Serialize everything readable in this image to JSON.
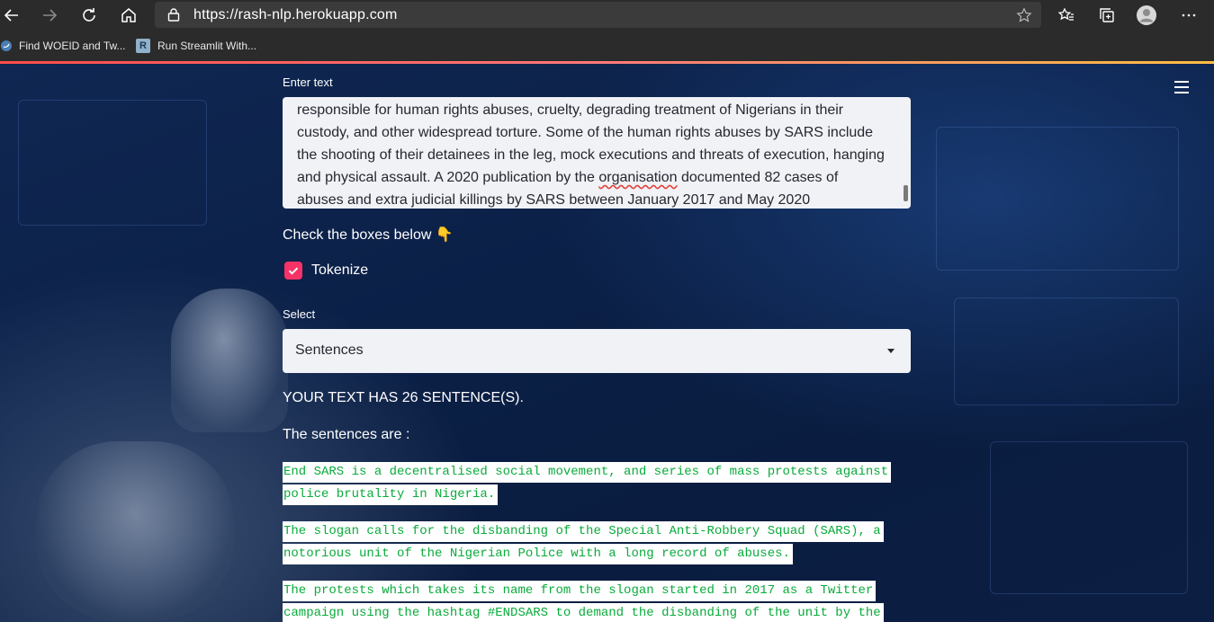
{
  "browser": {
    "url": "https://rash-nlp.herokuapp.com",
    "bookmarks": [
      {
        "label": "Find WOEID and Tw..."
      },
      {
        "label": "Run Streamlit With..."
      }
    ],
    "bookmark_badge": "R"
  },
  "app": {
    "input_label": "Enter text",
    "input_lines": [
      "responsible for human rights abuses, cruelty, degrading treatment of Nigerians in their",
      "custody, and other widespread torture. Some of the human rights abuses by SARS include",
      "the shooting of their detainees in the leg, mock executions and threats of execution, hanging",
      "and physical assault. A 2020 publication by the ",
      "organisation",
      " documented 82 cases of",
      "abuses and extra judicial killings by SARS between January 2017 and May 2020"
    ],
    "check_heading": "Check the boxes below 👇",
    "tokenize_label": "Tokenize",
    "tokenize_checked": true,
    "select_label": "Select",
    "select_value": "Sentences",
    "result_count": "YOUR TEXT HAS 26 SENTENCE(S).",
    "result_heading": "The sentences are :",
    "sentences": [
      [
        "End SARS is a decentralised social movement, and series of mass protests against",
        "police brutality in Nigeria."
      ],
      [
        "The slogan calls for the disbanding of the Special Anti-Robbery Squad (SARS), a",
        "notorious unit of the Nigerian Police with a long record of abuses."
      ],
      [
        "The protests which takes its name from the slogan started in 2017 as a Twitter",
        "campaign using the hashtag #ENDSARS to demand the disbanding of the unit by the"
      ]
    ]
  },
  "colors": {
    "accent": "#f63366",
    "code_green": "#09ab3b"
  }
}
